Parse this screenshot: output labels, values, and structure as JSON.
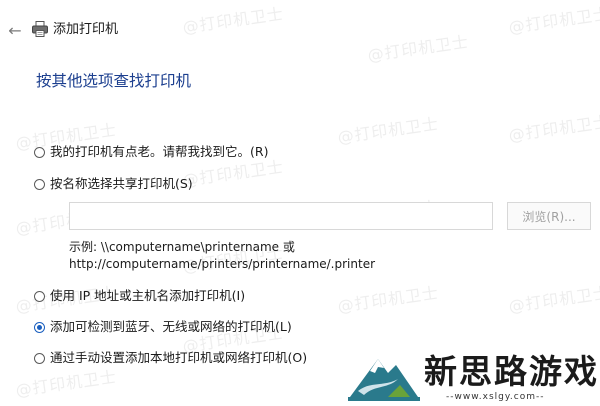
{
  "window": {
    "title": "添加打印机",
    "back_icon": "arrow-left-icon",
    "title_icon": "printer-icon"
  },
  "heading": "按其他选项查找打印机",
  "options": [
    {
      "label": "我的打印机有点老。请帮我找到它。(R)",
      "checked": false
    },
    {
      "label": "按名称选择共享打印机(S)",
      "checked": false
    },
    {
      "label": "使用 IP 地址或主机名添加打印机(I)",
      "checked": false
    },
    {
      "label": "添加可检测到蓝牙、无线或网络的打印机(L)",
      "checked": true
    },
    {
      "label": "通过手动设置添加本地打印机或网络打印机(O)",
      "checked": false
    }
  ],
  "share_input": {
    "value": "",
    "placeholder": ""
  },
  "browse_button": "浏览(R)...",
  "example": {
    "line1": "示例: \\\\computername\\printername 或",
    "line2": "http://computername/printers/printername/.printer"
  },
  "watermark": {
    "text": "@打印机卫士"
  },
  "logo": {
    "name": "新思路游戏",
    "url": "--www.xslgy.com--"
  },
  "colors": {
    "heading": "#1c3f8f",
    "accent": "#1a5fbf",
    "disabled_text": "#a0a0a0"
  }
}
